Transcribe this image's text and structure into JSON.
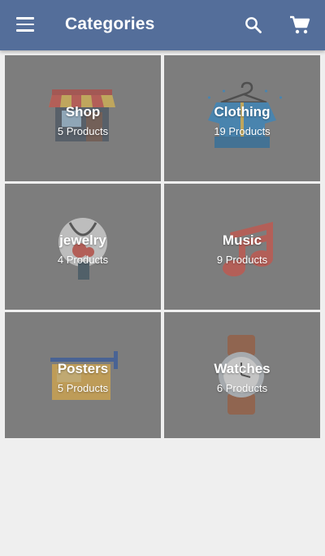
{
  "app_bar": {
    "title": "Categories",
    "background_color": "#546e9a",
    "icons": [
      "menu-icon",
      "search-icon",
      "cart-icon"
    ]
  },
  "categories": [
    {
      "name": "Shop",
      "count_label": "5 Products",
      "icon": "shop-icon"
    },
    {
      "name": "Clothing",
      "count_label": "19 Products",
      "icon": "clothing-icon"
    },
    {
      "name": "jewelry",
      "count_label": "4 Products",
      "icon": "jewelry-icon"
    },
    {
      "name": "Music",
      "count_label": "9 Products",
      "icon": "music-icon"
    },
    {
      "name": "Posters",
      "count_label": "5 Products",
      "icon": "poster-icon"
    },
    {
      "name": "Watches",
      "count_label": "6 Products",
      "icon": "watch-icon"
    }
  ]
}
